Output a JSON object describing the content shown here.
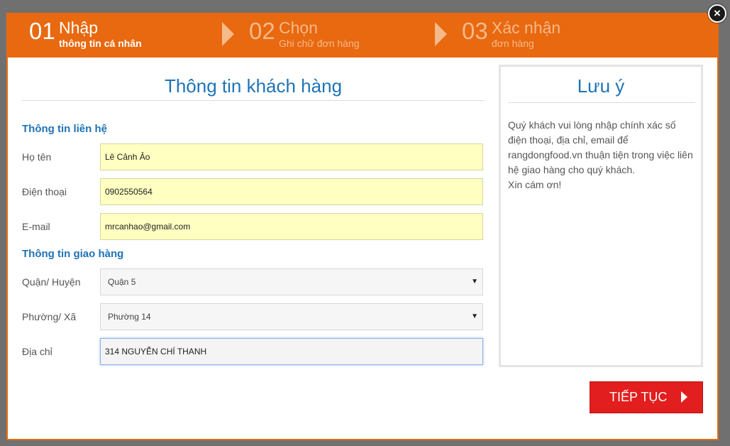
{
  "steps": [
    {
      "num": "01",
      "title": "Nhập",
      "subtitle": "thông tin cá nhân",
      "active": true
    },
    {
      "num": "02",
      "title": "Chọn",
      "subtitle": "Ghi chữ đơn hàng",
      "active": false
    },
    {
      "num": "03",
      "title": "Xác nhận",
      "subtitle": "đơn hàng",
      "active": false
    }
  ],
  "form": {
    "title": "Thông tin khách hàng",
    "contact_section": "Thông tin liên hệ",
    "delivery_section": "Thông tin giao hàng",
    "name_label": "Họ tên",
    "name_value": "Lê Cảnh Ảo",
    "phone_label": "Điện thoại",
    "phone_value": "0902550564",
    "email_label": "E-mail",
    "email_value": "mrcanhao@gmail.com",
    "district_label": "Quận/ Huyện",
    "district_value": "Quận 5",
    "ward_label": "Phường/ Xã",
    "ward_value": "Phường 14",
    "address_label": "Địa chỉ",
    "address_value": "314 NGUYỄN CHÍ THANH"
  },
  "note": {
    "title": "Lưu ý",
    "text": "Quý khách vui lòng nhập chính xác số điện thoại, địa chỉ, email để rangdongfood.vn thuận tiện trong việc liên hệ giao hàng cho quý khách.",
    "thanks": "Xin cám ơn!"
  },
  "buttons": {
    "next_label": "TIẾP TỤC",
    "close_label": "×"
  },
  "colors": {
    "accent": "#e8690f",
    "title_blue": "#1f73b7",
    "button_red": "#e21e1e"
  }
}
